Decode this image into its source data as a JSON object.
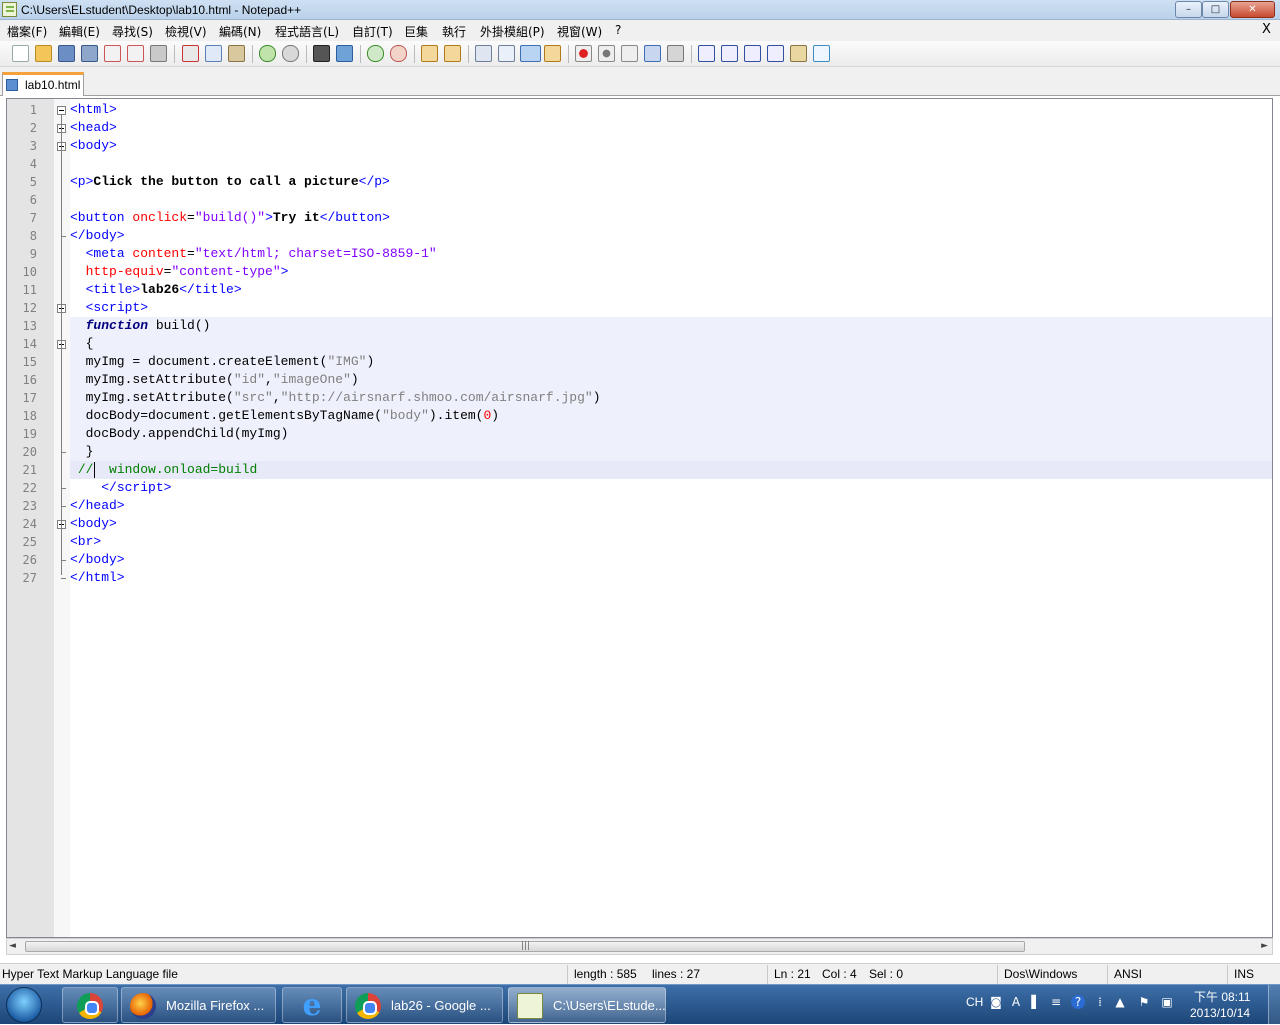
{
  "window": {
    "title": "C:\\Users\\ELstudent\\Desktop\\lab10.html - Notepad++",
    "minimize": "–",
    "maximize": "□",
    "close": "✕"
  },
  "menu": {
    "items": [
      "檔案(F)",
      "編輯(E)",
      "尋找(S)",
      "檢視(V)",
      "編碼(N)",
      "程式語言(L)",
      "自訂(T)",
      "巨集",
      "執行",
      "外掛模組(P)",
      "視窗(W)",
      "?"
    ],
    "close_x": "X"
  },
  "toolbar_icons": [
    "new-file-icon",
    "open-file-icon",
    "save-icon",
    "save-all-icon",
    "close-icon",
    "close-all-icon",
    "print-icon",
    "cut-icon",
    "copy-icon",
    "paste-icon",
    "undo-icon",
    "redo-icon",
    "find-icon",
    "replace-icon",
    "zoom-in-icon",
    "zoom-out-icon",
    "sync-vertical-icon",
    "sync-horizontal-icon",
    "word-wrap-icon",
    "show-all-chars-icon",
    "indent-guide-icon",
    "user-lang-icon",
    "record-macro-icon",
    "stop-record-icon",
    "play-macro-icon",
    "run-macro-multiple-icon",
    "save-macro-icon",
    "fold-all-icon",
    "move-up-icon",
    "move-down-icon",
    "unfold-all-icon",
    "doc-map-icon",
    "spell-check-icon"
  ],
  "tab": {
    "label": "lab10.html"
  },
  "code_lines": [
    {
      "n": "1",
      "html": "<span class='t'>&lt;html&gt;</span>"
    },
    {
      "n": "2",
      "html": "<span class='t'>&lt;head&gt;</span>"
    },
    {
      "n": "3",
      "html": "<span class='t'>&lt;body&gt;</span>"
    },
    {
      "n": "4",
      "html": ""
    },
    {
      "n": "5",
      "html": "<span class='t'>&lt;p&gt;</span><span class='bold'>Click the button to call a picture</span><span class='t'>&lt;/p&gt;</span>"
    },
    {
      "n": "6",
      "html": ""
    },
    {
      "n": "7",
      "html": "<span class='t'>&lt;button </span><span class='a'>onclick</span>=<span class='v'>\"build()\"</span><span class='t'>&gt;</span><span class='bold'>Try it</span><span class='t'>&lt;/button&gt;</span>"
    },
    {
      "n": "8",
      "html": "<span class='t'>&lt;/body&gt;</span>"
    },
    {
      "n": "9",
      "html": "  <span class='t'>&lt;meta </span><span class='a'>content</span>=<span class='v'>\"text/html; charset=ISO-8859-1\"</span>"
    },
    {
      "n": "10",
      "html": "  <span class='a'>http-equiv</span>=<span class='v'>\"content-type\"</span><span class='t'>&gt;</span>"
    },
    {
      "n": "11",
      "html": "  <span class='t'>&lt;title&gt;</span><span class='bold'>lab26</span><span class='t'>&lt;/title&gt;</span>"
    },
    {
      "n": "12",
      "html": "  <span class='t'>&lt;script&gt;</span>"
    },
    {
      "n": "13",
      "html": "  <span class='kw'>function</span> build()"
    },
    {
      "n": "14",
      "html": "  {"
    },
    {
      "n": "15",
      "html": "  myImg = document.createElement(<span class='str'>\"IMG\"</span>)"
    },
    {
      "n": "16",
      "html": "  myImg.setAttribute(<span class='str'>\"id\"</span>,<span class='str'>\"imageOne\"</span>)"
    },
    {
      "n": "17",
      "html": "  myImg.setAttribute(<span class='str'>\"src\"</span>,<span class='str'>\"http://airsnarf.shmoo.com/airsnarf.jpg\"</span>)"
    },
    {
      "n": "18",
      "html": "  docBody=document.getElementsByTagName(<span class='str'>\"body\"</span>).item(<span class='num'>0</span>)"
    },
    {
      "n": "19",
      "html": "  docBody.appendChild(myImg)"
    },
    {
      "n": "20",
      "html": "  }"
    },
    {
      "n": "21",
      "html": " <span class='cm'>//  window.onload=build</span>"
    },
    {
      "n": "22",
      "html": "    <span class='t'>&lt;/script&gt;</span>"
    },
    {
      "n": "23",
      "html": "<span class='t'>&lt;/head&gt;</span>"
    },
    {
      "n": "24",
      "html": "<span class='t'>&lt;body&gt;</span>"
    },
    {
      "n": "25",
      "html": "<span class='t'>&lt;br&gt;</span>"
    },
    {
      "n": "26",
      "html": "<span class='t'>&lt;/body&gt;</span>"
    },
    {
      "n": "27",
      "html": "<span class='t'>&lt;/html&gt;</span>"
    }
  ],
  "status": {
    "file_type": "Hyper Text Markup Language file",
    "length": "length : 585",
    "lines": "lines : 27",
    "ln": "Ln : 21",
    "col": "Col : 4",
    "sel": "Sel : 0",
    "eol": "Dos\\Windows",
    "encoding": "ANSI",
    "mode": "INS"
  },
  "taskbar": {
    "firefox": "Mozilla Firefox ...",
    "chrome_lab26": "lab26 - Google ...",
    "notepad": "C:\\Users\\ELstude..."
  },
  "tray": {
    "lang": "CH",
    "time": "下午 08:11",
    "date": "2013/10/14"
  }
}
